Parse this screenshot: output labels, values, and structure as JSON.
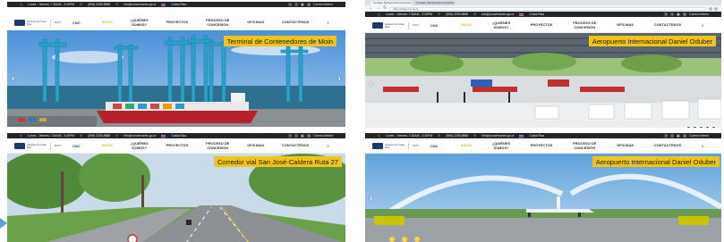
{
  "colors": {
    "accent_yellow": "#f0c419",
    "infobar_bg": "#222629",
    "brand_navy": "#1e3a68",
    "menu_active": "#e0b624"
  },
  "browser": {
    "tab_title_1": "Consejo Nacional de Concesiones",
    "tab_title_2": "Consejo Nacional de Concesiones",
    "url": "https://www.cnc.go.cr"
  },
  "infobar": {
    "hours": "Lunes - Viernes: 7:30AM - 3:30PM",
    "phone": "(506) 2253-8888",
    "email": "info@concesiones.go.cr",
    "country": "Costa Rica",
    "social_icons": [
      "facebook-icon",
      "twitter-icon",
      "youtube-icon",
      "instagram-icon"
    ],
    "webmail": "Correo Interno"
  },
  "logo": {
    "gov_text": "Gobierno de Costa Rica",
    "ministry_text": "MOPT",
    "acronym": "CNC"
  },
  "menu": {
    "items": [
      {
        "label": "INICIO",
        "active": true
      },
      {
        "label": "¿QUIÉNES\nSOMOS?",
        "active": false
      },
      {
        "label": "PROYECTOS",
        "active": false
      },
      {
        "label": "PROCESO DE\nCONCESIÓN",
        "active": false
      },
      {
        "label": "OFICINAS",
        "active": false
      },
      {
        "label": "CONTÁCTENOS",
        "active": false
      }
    ],
    "search_icon": "search-icon"
  },
  "slides": [
    {
      "title": "Terminal de Contenedores de Moin",
      "scene": "port"
    },
    {
      "title": "Aeropuerto Internacional Daniel Oduber",
      "scene": "terminal"
    },
    {
      "title": "Corredor vial San José-Caldera Ruta 27",
      "scene": "road"
    },
    {
      "title": "Aeropuerto Internacional Daniel Oduber",
      "scene": "runway"
    }
  ],
  "carousel": {
    "prev_icon": "chevron-left-icon",
    "next_icon": "chevron-right-icon"
  }
}
